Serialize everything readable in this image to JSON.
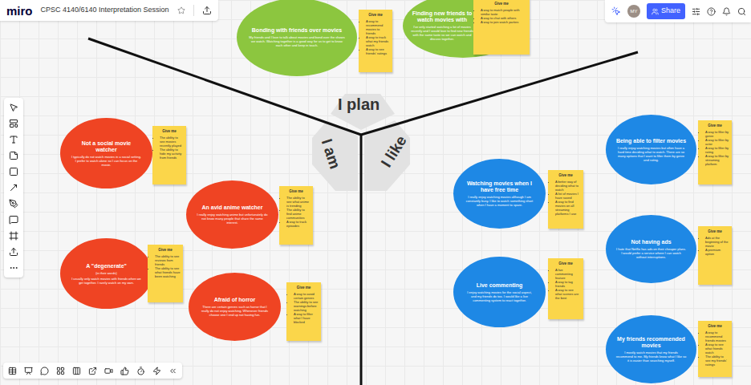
{
  "app": {
    "logo": "miro",
    "board_title": "CPSC 4140/6140 Interpretation Session"
  },
  "topbar": {
    "avatar": "MY",
    "share": "Share"
  },
  "hub": [
    {
      "label": "I plan"
    },
    {
      "label": "I am"
    },
    {
      "label": "I like"
    }
  ],
  "nodes": [
    {
      "title": "Bonding with friends over movies",
      "subtitle": "",
      "body": "My friends and I love to talk about movies and bond over the shows we watch. Watching together is a good way for us to get to know each other and keep in touch.",
      "color": "#8cc63f",
      "note": {
        "heading": "Give me",
        "items": [
          "A way to recommend movies to friends",
          "A way to track what my friends watch",
          "A way to see friends' ratings"
        ]
      }
    },
    {
      "title": "Finding new friends to watch movies with",
      "subtitle": "",
      "body": "I've only started watching a lot of movies recently and I would love to find new friends with the same taste so we can watch and discuss together.",
      "color": "#8cc63f",
      "note": {
        "heading": "Give me",
        "items": [
          "A way to match people with similar taste",
          "A way to chat with others",
          "A way to join watch parties"
        ]
      }
    },
    {
      "title": "Not a social movie watcher",
      "subtitle": "",
      "body": "I typically do not watch movies in a social setting. I prefer to watch alone so I can focus on the movie.",
      "color": "#ef4423",
      "note": {
        "heading": "Give me",
        "items": [
          "The ability to see movies recently played",
          "The ability to hide my activity from friends"
        ]
      }
    },
    {
      "title": "An avid anime watcher",
      "subtitle": "",
      "body": "I really enjoy watching anime but unfortunately do not know many people that share the same interest.",
      "color": "#ef4423",
      "note": {
        "heading": "Give me",
        "items": [
          "The ability to see what anime is trending",
          "The ability to find anime communities",
          "A way to track episodes"
        ]
      }
    },
    {
      "title": "A \"degenerate\"",
      "subtitle": "(in their words)",
      "body": "I usually only watch movies with friends when we get together. I rarely watch on my own.",
      "color": "#ef4423",
      "note": {
        "heading": "Give me",
        "items": [
          "The ability to see reviews from friends",
          "The ability to see what friends have been watching"
        ]
      }
    },
    {
      "title": "Afraid of horror",
      "subtitle": "",
      "body": "There are certain genres such as horror that I really do not enjoy watching. Whenever friends choose one I end up not having fun.",
      "color": "#ef4423",
      "note": {
        "heading": "Give me",
        "items": [
          "A way to avoid certain genres",
          "The ability to see warnings before watching",
          "A way to filter what I have blocked"
        ]
      }
    },
    {
      "title": "Watching movies when I have free time",
      "subtitle": "",
      "body": "I really enjoy watching movies although I am constantly busy. I like to watch something short when I have a moment to spare.",
      "color": "#1e88e5",
      "note": {
        "heading": "Give me",
        "items": [
          "A better way of deciding what to watch",
          "A list of movies I have saved",
          "A way to find movies on all streaming platforms I use"
        ]
      }
    },
    {
      "title": "Live commenting",
      "subtitle": "",
      "body": "I enjoy watching movies for the social aspect, and my friends do too. I would like a live commenting system to react together.",
      "color": "#1e88e5",
      "note": {
        "heading": "Give me",
        "items": [
          "A live commenting feature",
          "A way to tag friends",
          "A way to see what scenes are the best"
        ]
      }
    },
    {
      "title": "Being able to filter movies",
      "subtitle": "",
      "body": "I really enjoy watching movies but often have a hard time deciding what to watch. There are so many options that I want to filter them by genre and rating.",
      "color": "#1e88e5",
      "note": {
        "heading": "Give me",
        "items": [
          "A way to filter by genre",
          "A way to filter by actor",
          "A way to filter by rating",
          "A way to filter by streaming platform"
        ]
      }
    },
    {
      "title": "Not having ads",
      "subtitle": "",
      "body": "I hate that Netflix has ads on their cheaper plans. I would prefer a service where I can watch without interruptions.",
      "color": "#1e88e5",
      "note": {
        "heading": "Give me",
        "items": [
          "Ads at the beginning of the movie",
          "A premium option"
        ]
      }
    },
    {
      "title": "My friends recommended movies",
      "subtitle": "",
      "body": "I mostly watch movies that my friends recommend to me. My friends know what I like so it is easier than searching myself.",
      "color": "#1e88e5",
      "note": {
        "heading": "Give me",
        "items": [
          "A way to recommend friends movies",
          "A way to see what friends watch",
          "The ability to see my friends' ratings"
        ]
      }
    }
  ]
}
